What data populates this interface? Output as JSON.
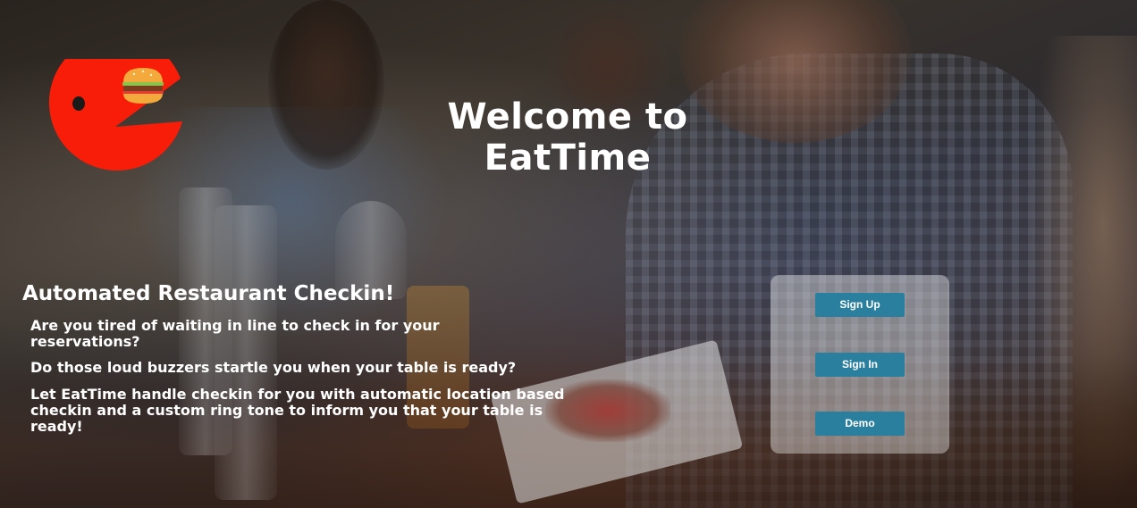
{
  "hero": {
    "title": "Welcome to EatTime"
  },
  "intro": {
    "headline": "Automated Restaurant Checkin!",
    "paragraphs": [
      "Are you tired of waiting in line to check in for your reservations?",
      "Do those loud buzzers startle you when your table is ready?",
      "Let EatTime handle checkin for you with automatic location based checkin and a custom ring tone to inform you that your table is ready!"
    ]
  },
  "auth": {
    "signup_label": "Sign Up",
    "signin_label": "Sign In",
    "demo_label": "Demo"
  },
  "colors": {
    "logo_red": "#f71d08",
    "button_blue": "#2a7f9e",
    "text": "#ffffff"
  },
  "icons": {
    "logo": "pacman-eating-burger-logo"
  }
}
